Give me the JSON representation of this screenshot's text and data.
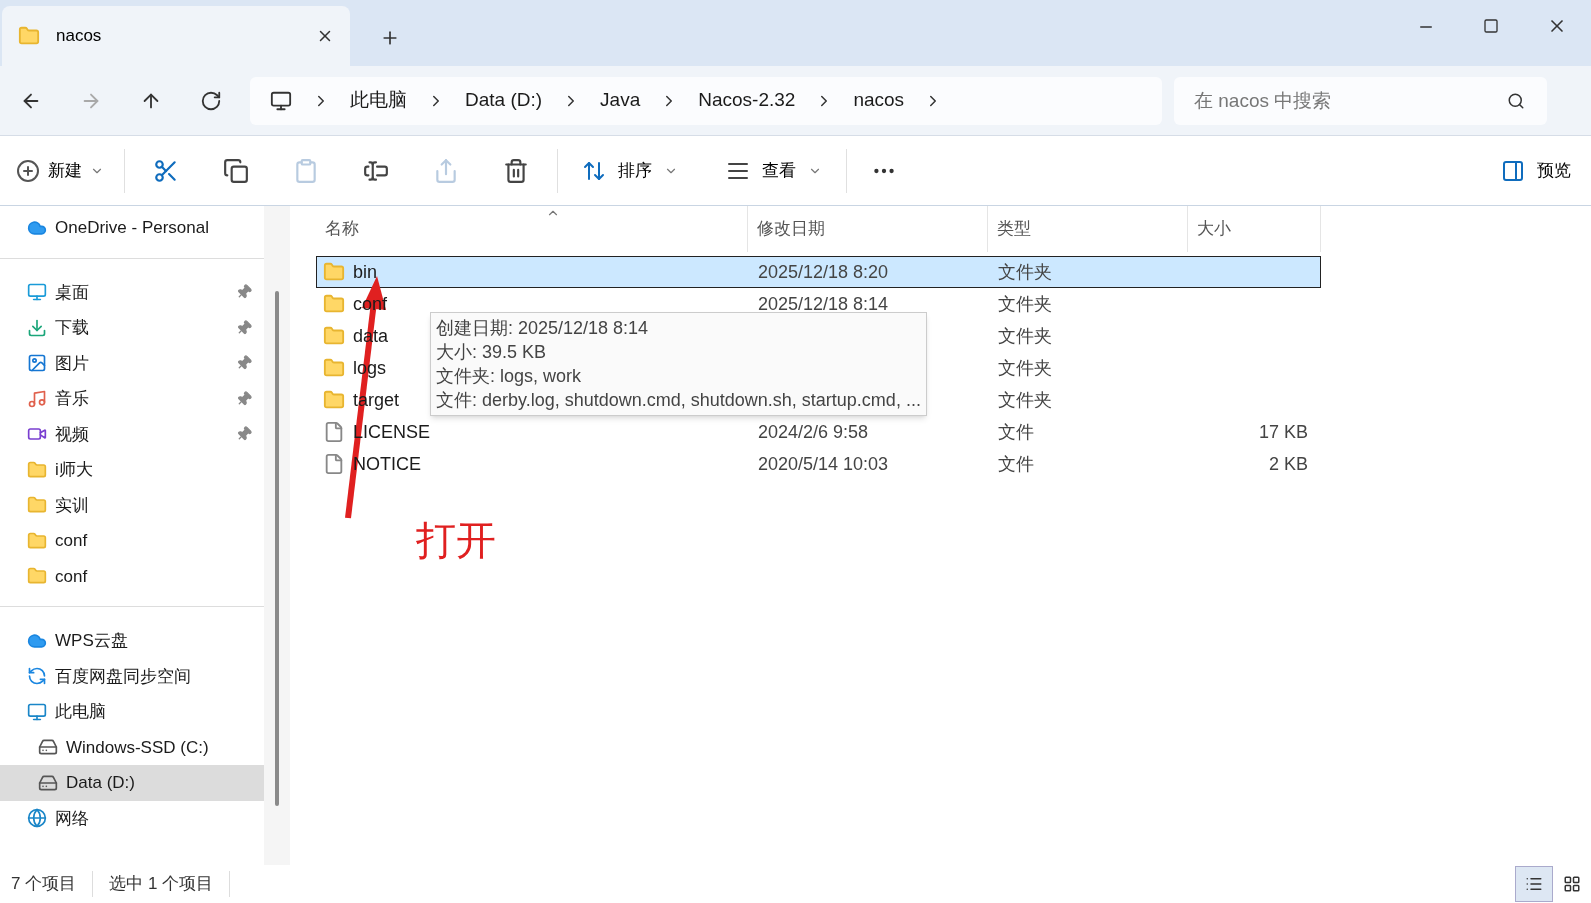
{
  "tab": {
    "title": "nacos"
  },
  "nav": [
    {
      "kind": "back",
      "disabled": false
    },
    {
      "kind": "forward",
      "disabled": true
    },
    {
      "kind": "up",
      "disabled": false
    },
    {
      "kind": "refresh",
      "disabled": false
    }
  ],
  "breadcrumbs": [
    "此电脑",
    "Data (D:)",
    "Java",
    "Nacos-2.32",
    "nacos"
  ],
  "search": {
    "placeholder": "在 nacos 中搜索"
  },
  "toolbar": {
    "new": "新建",
    "actions": [
      {
        "kind": "cut",
        "disabled": false
      },
      {
        "kind": "copy",
        "disabled": false
      },
      {
        "kind": "paste",
        "disabled": true
      },
      {
        "kind": "rename",
        "disabled": false
      },
      {
        "kind": "share",
        "disabled": true
      },
      {
        "kind": "delete",
        "disabled": false
      }
    ],
    "sort": "排序",
    "view": "查看",
    "preview": "预览"
  },
  "sidebar": {
    "sections": [
      [
        {
          "label": "OneDrive - Personal",
          "kind": "cloud",
          "pinned": false,
          "selected": false
        }
      ],
      [
        {
          "label": "桌面",
          "kind": "desktop",
          "pinned": true,
          "selected": false
        },
        {
          "label": "下载",
          "kind": "download",
          "pinned": true,
          "selected": false
        },
        {
          "label": "图片",
          "kind": "pictures",
          "pinned": true,
          "selected": false
        },
        {
          "label": "音乐",
          "kind": "music",
          "pinned": true,
          "selected": false
        },
        {
          "label": "视频",
          "kind": "video",
          "pinned": true,
          "selected": false
        },
        {
          "label": "i师大",
          "kind": "folder",
          "pinned": false,
          "selected": false
        },
        {
          "label": "实训",
          "kind": "folder",
          "pinned": false,
          "selected": false
        },
        {
          "label": "conf",
          "kind": "folder",
          "pinned": false,
          "selected": false
        },
        {
          "label": "conf",
          "kind": "folder",
          "pinned": false,
          "selected": false
        }
      ],
      [
        {
          "label": "WPS云盘",
          "kind": "cloud",
          "pinned": false,
          "selected": false
        },
        {
          "label": "百度网盘同步空间",
          "kind": "sync",
          "pinned": false,
          "selected": false
        },
        {
          "label": "此电脑",
          "kind": "pc",
          "pinned": false,
          "selected": false,
          "children": [
            {
              "label": "Windows-SSD (C:)",
              "kind": "drive",
              "pinned": false,
              "selected": false
            },
            {
              "label": "Data (D:)",
              "kind": "drive",
              "pinned": false,
              "selected": true
            }
          ]
        },
        {
          "label": "网络",
          "kind": "network",
          "pinned": false,
          "selected": false
        }
      ]
    ]
  },
  "columns": [
    "名称",
    "修改日期",
    "类型",
    "大小"
  ],
  "files": [
    {
      "name": "bin",
      "date": "2025/12/18 8:20",
      "type": "文件夹",
      "kind": "folder",
      "selected": true
    },
    {
      "name": "conf",
      "date": "2025/12/18 8:14",
      "type": "文件夹",
      "kind": "folder",
      "selected": false
    },
    {
      "name": "data",
      "type": "文件夹",
      "kind": "folder",
      "selected": false
    },
    {
      "name": "logs",
      "type": "文件夹",
      "kind": "folder",
      "selected": false
    },
    {
      "name": "target",
      "type": "文件夹",
      "kind": "folder",
      "selected": false
    },
    {
      "name": "LICENSE",
      "date": "2024/2/6 9:58",
      "type": "文件",
      "size": "17 KB",
      "kind": "file",
      "selected": false
    },
    {
      "name": "NOTICE",
      "date": "2020/5/14 10:03",
      "type": "文件",
      "size": "2 KB",
      "kind": "file",
      "selected": false
    }
  ],
  "tooltip": [
    "创建日期: 2025/12/18 8:14",
    "大小: 39.5 KB",
    "文件夹: logs, work",
    "文件: derby.log, shutdown.cmd, shutdown.sh, startup.cmd, ..."
  ],
  "annotation": {
    "text": "打开"
  },
  "status": {
    "count": "7 个项目",
    "selection": "选中 1 个项目"
  },
  "views": [
    {
      "kind": "details",
      "selected": true
    },
    {
      "kind": "tiles",
      "selected": false
    }
  ]
}
